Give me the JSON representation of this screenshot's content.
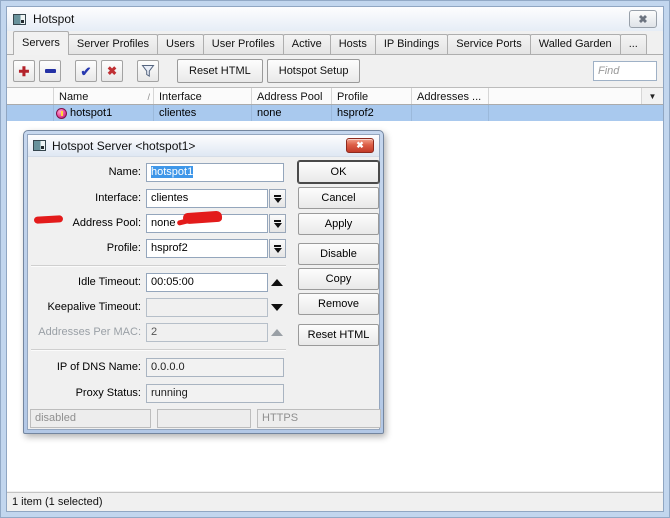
{
  "window": {
    "title": "Hotspot",
    "status_bar": "1 item (1 selected)"
  },
  "icons": {
    "add": "✚",
    "enable": "✔",
    "disable": "✖",
    "close": "✖",
    "chooser": "▼",
    "sort": "/"
  },
  "tabs": [
    {
      "label": "Servers",
      "active": true
    },
    {
      "label": "Server Profiles"
    },
    {
      "label": "Users"
    },
    {
      "label": "User Profiles"
    },
    {
      "label": "Active"
    },
    {
      "label": "Hosts"
    },
    {
      "label": "IP Bindings"
    },
    {
      "label": "Service Ports"
    },
    {
      "label": "Walled Garden"
    },
    {
      "label": "..."
    }
  ],
  "toolbar": {
    "reset_html": "Reset HTML",
    "hotspot_setup": "Hotspot Setup",
    "find_placeholder": "Find"
  },
  "table": {
    "headers": [
      "Name",
      "Interface",
      "Address Pool",
      "Profile",
      "Addresses ..."
    ],
    "rows": [
      {
        "name": "hotspot1",
        "interface": "clientes",
        "address_pool": "none",
        "profile": "hsprof2",
        "addresses": ""
      }
    ]
  },
  "dialog": {
    "title": "Hotspot Server <hotspot1>",
    "fields": {
      "name": {
        "label": "Name:",
        "value": "hotspot1"
      },
      "interface": {
        "label": "Interface:",
        "value": "clientes"
      },
      "address_pool": {
        "label": "Address Pool:",
        "value": "none"
      },
      "profile": {
        "label": "Profile:",
        "value": "hsprof2"
      },
      "idle_timeout": {
        "label": "Idle Timeout:",
        "value": "00:05:00"
      },
      "keepalive_timeout": {
        "label": "Keepalive Timeout:",
        "value": ""
      },
      "addresses_per_mac": {
        "label": "Addresses Per MAC:",
        "value": "2"
      },
      "ip_of_dns_name": {
        "label": "IP of DNS Name:",
        "value": "0.0.0.0"
      },
      "proxy_status": {
        "label": "Proxy Status:",
        "value": "running"
      }
    },
    "buttons": {
      "ok": "OK",
      "cancel": "Cancel",
      "apply": "Apply",
      "disable": "Disable",
      "copy": "Copy",
      "remove": "Remove",
      "reset_html": "Reset HTML"
    },
    "status_cells": [
      "disabled",
      "",
      "HTTPS"
    ]
  },
  "colors": {
    "selection_blue": "#3f97e9",
    "row_selected": "#a9c9ee",
    "annotation_red": "#e31b1b",
    "frame_blue": "#c2d6ee",
    "dialog_close_red": "#c23a28"
  }
}
